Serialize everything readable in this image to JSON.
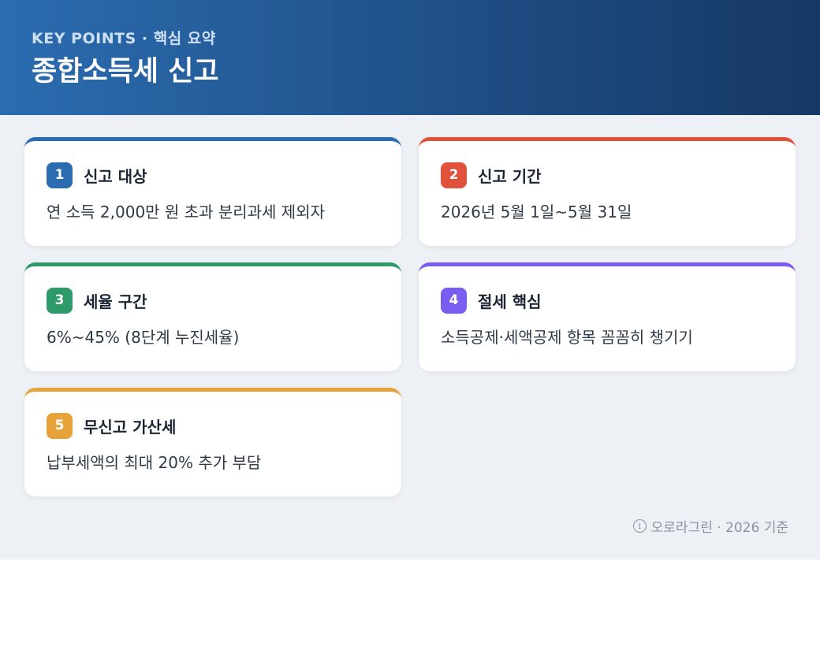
{
  "header": {
    "eyebrow": "KEY POINTS · 핵심 요약",
    "title": "종합소득세 신고"
  },
  "cards": [
    {
      "number": "1",
      "title": "신고 대상",
      "body": "연 소득 2,000만 원 초과 분리과세 제외자",
      "color": "#2b6cb0"
    },
    {
      "number": "2",
      "title": "신고 기간",
      "body": "2026년 5월 1일~5월 31일",
      "color": "#e0523b"
    },
    {
      "number": "3",
      "title": "세율 구간",
      "body": "6%~45% (8단계 누진세율)",
      "color": "#2e9a6a"
    },
    {
      "number": "4",
      "title": "절세 핵심",
      "body": "소득공제·세액공제 항목 꼼꼼히 챙기기",
      "color": "#7b5cf0"
    },
    {
      "number": "5",
      "title": "무신고 가산세",
      "body": "납부세액의 최대 20% 추가 부담",
      "color": "#e8a23a"
    }
  ],
  "footer": {
    "icon": "info-icon",
    "text": "오로라그린 · 2026 기준"
  }
}
